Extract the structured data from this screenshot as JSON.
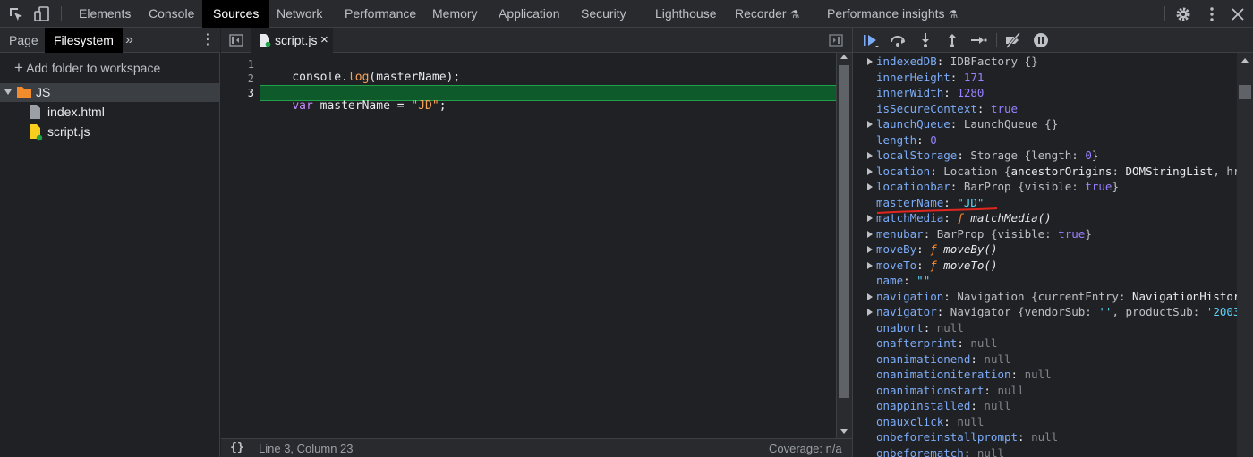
{
  "topbar": {
    "tabs": [
      {
        "label": "Elements",
        "active": false
      },
      {
        "label": "Console",
        "active": false
      },
      {
        "label": "Sources",
        "active": true
      },
      {
        "label": "Network",
        "active": false
      },
      {
        "label": "Performance",
        "active": false
      },
      {
        "label": "Memory",
        "active": false
      },
      {
        "label": "Application",
        "active": false
      },
      {
        "label": "Security",
        "active": false
      },
      {
        "label": "Lighthouse",
        "active": false
      },
      {
        "label": "Recorder",
        "active": false,
        "experimental": true
      },
      {
        "label": "Performance insights",
        "active": false,
        "experimental": true
      }
    ],
    "experimental_glyph": "⚗"
  },
  "navigator": {
    "tabs": [
      "Page",
      "Filesystem"
    ],
    "more_glyph": "»",
    "menu_glyph": "⋮",
    "add_folder": "Add folder to workspace",
    "add_glyph": "+",
    "tree": {
      "root": "JS",
      "files": [
        "index.html",
        "script.js"
      ]
    }
  },
  "editor": {
    "tab_label": "script.js",
    "close_glyph": "×",
    "lines": [
      {
        "number": "1",
        "text": "console.log(masterName);"
      },
      {
        "number": "2",
        "text": ""
      },
      {
        "number": "3",
        "text": "var masterName = \"JD\";"
      }
    ],
    "status": {
      "format_glyph": "{}",
      "position": "Line 3, Column 23",
      "coverage": "Coverage: n/a"
    }
  },
  "scope": {
    "colors": {
      "key": "#7cacf8",
      "number": "#9980ff",
      "string": "#5cd5fb",
      "null": "#80868b",
      "function_f": "#ff8c2e",
      "annotation": "#e0261f"
    },
    "highlight_key": "masterName"
  }
}
